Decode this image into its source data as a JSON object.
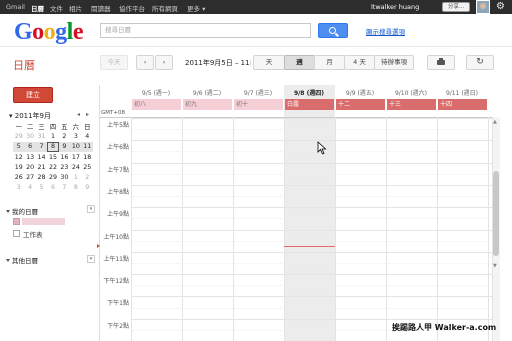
{
  "topbar": {
    "nav": [
      "Gmail",
      "日曆",
      "文件",
      "相片",
      "閱讀器",
      "協作平台",
      "所有網頁",
      "更多 ▾"
    ],
    "user": "ltwalker huang",
    "share": "分享..."
  },
  "logo": {
    "letters": [
      "G",
      "o",
      "o",
      "g",
      "l",
      "e"
    ],
    "colors": [
      "#3369e8",
      "#d50f25",
      "#eeb211",
      "#3369e8",
      "#009925",
      "#d50f25"
    ]
  },
  "search": {
    "placeholder": "搜尋日曆",
    "options_link": "顯示搜尋選項"
  },
  "app": {
    "title": "日曆"
  },
  "toolbar": {
    "today": "今天",
    "prev": "‹",
    "next": "›",
    "date_range": "2011年9月5日 – 11日",
    "views": {
      "day": "天",
      "week": "週",
      "month": "月",
      "four_day": "4 天",
      "agenda": "待辦事項"
    },
    "active_view": "週"
  },
  "sidebar": {
    "create": "建立",
    "mini_cal": {
      "title": "▾ 2011年9月",
      "prev": "◂",
      "next": "▸",
      "weekdays": [
        "一",
        "二",
        "三",
        "四",
        "五",
        "六",
        "日"
      ],
      "weeks": [
        [
          "29",
          "30",
          "31",
          "1",
          "2",
          "3",
          "4"
        ],
        [
          "5",
          "6",
          "7",
          "8",
          "9",
          "10",
          "11"
        ],
        [
          "12",
          "13",
          "14",
          "15",
          "16",
          "17",
          "18"
        ],
        [
          "19",
          "20",
          "21",
          "22",
          "23",
          "24",
          "25"
        ],
        [
          "26",
          "27",
          "28",
          "29",
          "30",
          "1",
          "2"
        ],
        [
          "3",
          "4",
          "5",
          "6",
          "7",
          "8",
          "9"
        ]
      ],
      "current_week_index": 1,
      "today": "8"
    },
    "my_calendars": {
      "title": "我的日曆",
      "toggle": "▾",
      "items": [
        "",
        "工作表"
      ]
    },
    "other_calendars": {
      "title": "其他日曆",
      "toggle": "▾"
    }
  },
  "week": {
    "gmt": "GMT+08",
    "days": [
      {
        "header": "9/5 (週一)",
        "allday": "初八",
        "style": "lunar-light"
      },
      {
        "header": "9/6 (週二)",
        "allday": "初九",
        "style": "lunar-light"
      },
      {
        "header": "9/7 (週三)",
        "allday": "初十",
        "style": "lunar-light"
      },
      {
        "header": "9/8 (週四)",
        "allday": "白露",
        "style": "lunar-red"
      },
      {
        "header": "9/9 (週五)",
        "allday": "十二",
        "style": "lunar-red"
      },
      {
        "header": "9/10 (週六)",
        "allday": "十三",
        "style": "lunar-red"
      },
      {
        "header": "9/11 (週日)",
        "allday": "十四",
        "style": "lunar-red"
      }
    ],
    "hours": [
      "上午5點",
      "上午6點",
      "上午7點",
      "上午8點",
      "上午9點",
      "上午10點",
      "上午11點",
      "下午12點",
      "下午1點",
      "下午2點"
    ]
  },
  "watermark": "挨踢路人甲 Walker-a.com"
}
